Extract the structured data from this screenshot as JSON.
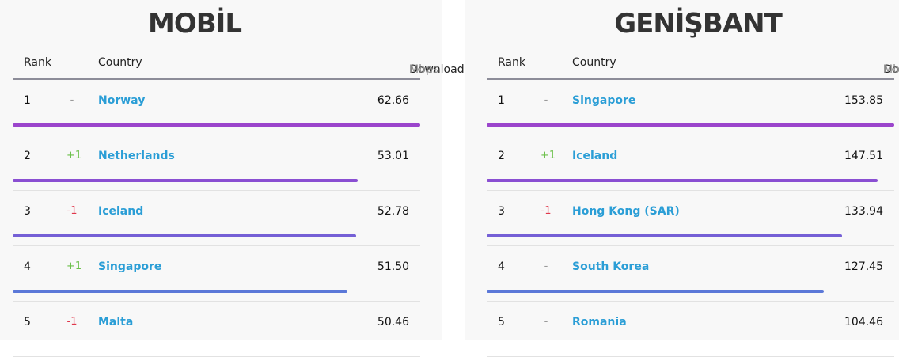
{
  "mobile": {
    "title": "MOBİL",
    "headers": {
      "rank": "Rank",
      "country": "Country",
      "download": "Download",
      "unit": "Mbps"
    },
    "rows": [
      {
        "rank": "1",
        "change": "-",
        "change_type": "same",
        "country": "Norway",
        "value": "62.66",
        "fraction": 1.0,
        "color": "#9b45cc"
      },
      {
        "rank": "2",
        "change": "+1",
        "change_type": "up",
        "country": "Netherlands",
        "value": "53.01",
        "fraction": 0.846,
        "color": "#8a4fd2"
      },
      {
        "rank": "3",
        "change": "-1",
        "change_type": "down",
        "country": "Iceland",
        "value": "52.78",
        "fraction": 0.842,
        "color": "#7560d6"
      },
      {
        "rank": "4",
        "change": "+1",
        "change_type": "up",
        "country": "Singapore",
        "value": "51.50",
        "fraction": 0.822,
        "color": "#5b78d8"
      },
      {
        "rank": "5",
        "change": "-1",
        "change_type": "down",
        "country": "Malta",
        "value": "50.46",
        "fraction": 0.805,
        "color": "#4a8ad8"
      }
    ]
  },
  "broadband": {
    "title": "GENİŞBANT",
    "headers": {
      "rank": "Rank",
      "country": "Country",
      "download": "Download",
      "unit": "Mbps"
    },
    "rows": [
      {
        "rank": "1",
        "change": "-",
        "change_type": "same",
        "country": "Singapore",
        "value": "153.85",
        "fraction": 1.0,
        "color": "#9b45cc"
      },
      {
        "rank": "2",
        "change": "+1",
        "change_type": "up",
        "country": "Iceland",
        "value": "147.51",
        "fraction": 0.959,
        "color": "#8a4fd2"
      },
      {
        "rank": "3",
        "change": "-1",
        "change_type": "down",
        "country": "Hong Kong (SAR)",
        "value": "133.94",
        "fraction": 0.871,
        "color": "#7560d6"
      },
      {
        "rank": "4",
        "change": "-",
        "change_type": "same",
        "country": "South Korea",
        "value": "127.45",
        "fraction": 0.828,
        "color": "#5b78d8"
      },
      {
        "rank": "5",
        "change": "-",
        "change_type": "same",
        "country": "Romania",
        "value": "104.46",
        "fraction": 0.679,
        "color": "#4a8ad8"
      }
    ]
  }
}
